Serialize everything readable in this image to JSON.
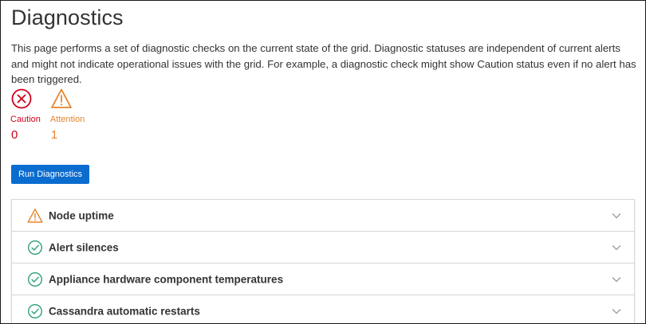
{
  "page": {
    "title": "Diagnostics",
    "description": "This page performs a set of diagnostic checks on the current state of the grid. Diagnostic statuses are independent of current alerts and might not indicate operational issues with the grid. For example, a diagnostic check might show Caution status even if no alert has been triggered."
  },
  "summary": {
    "caution": {
      "label": "Caution",
      "count": "0",
      "icon": "caution-x-circle-icon",
      "color": "#d0021b"
    },
    "attention": {
      "label": "Attention",
      "count": "1",
      "icon": "attention-warning-icon",
      "color": "#e8842c"
    }
  },
  "actions": {
    "run_label": "Run Diagnostics",
    "run_color": "#0a6ccf"
  },
  "checks": [
    {
      "title": "Node uptime",
      "status": "attention",
      "icon": "warning-icon"
    },
    {
      "title": "Alert silences",
      "status": "normal",
      "icon": "check-circle-icon"
    },
    {
      "title": "Appliance hardware component temperatures",
      "status": "normal",
      "icon": "check-circle-icon"
    },
    {
      "title": "Cassandra automatic restarts",
      "status": "normal",
      "icon": "check-circle-icon"
    }
  ],
  "colors": {
    "normal": "#2e9e7e",
    "attention": "#e8842c",
    "caution": "#d0021b"
  }
}
